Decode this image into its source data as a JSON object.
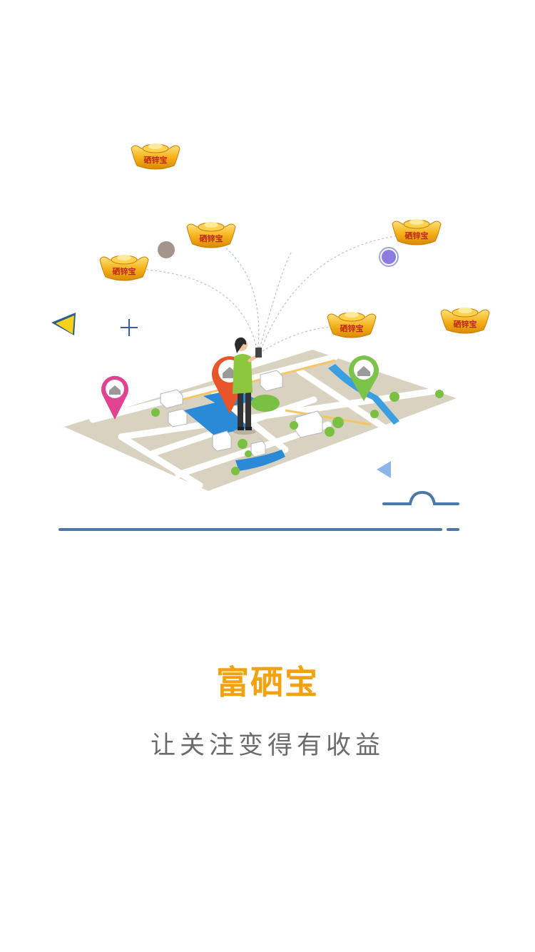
{
  "app": {
    "name": "富硒宝",
    "slogan": "让关注变得有收益"
  },
  "illustration": {
    "ingot_label": "硒锌宝",
    "colors": {
      "gold": "#f5b21a",
      "gold_dark": "#d98a06",
      "map_ground": "#d9d2c1",
      "road": "#ffffff",
      "water": "#2b8ad8",
      "line_blue": "#4a78a8",
      "pin_red": "#e8552a",
      "pin_green": "#7cc34b",
      "pin_pink": "#e0438f",
      "title_orange": "#f2a20f"
    }
  }
}
